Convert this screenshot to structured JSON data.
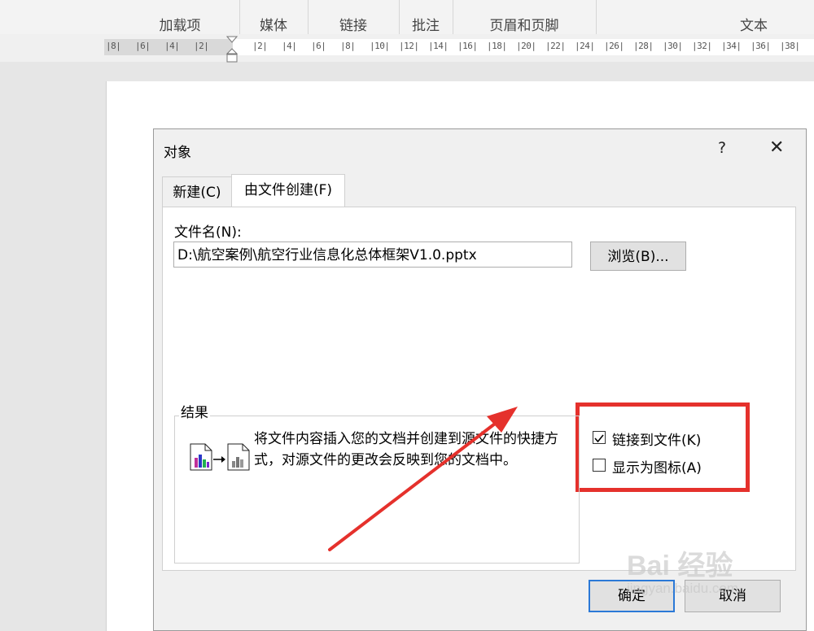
{
  "ribbon": {
    "groups": [
      "加载项",
      "媒体",
      "链接",
      "批注",
      "页眉和页脚",
      "文本"
    ]
  },
  "ruler": {
    "ticks": [
      "8",
      "6",
      "4",
      "2",
      "2",
      "4",
      "6",
      "8",
      "10",
      "12",
      "14",
      "16",
      "18",
      "20",
      "22",
      "24",
      "26",
      "28",
      "30",
      "32",
      "34",
      "36",
      "38"
    ]
  },
  "dialog": {
    "title": "对象",
    "help_label": "?",
    "close_label": "✕",
    "tabs": [
      {
        "label": "新建(C)",
        "mnemonic": "C"
      },
      {
        "label": "由文件创建(F)",
        "mnemonic": "F"
      }
    ],
    "file_label": "文件名(N):",
    "file_value": "D:\\航空案例\\航空行业信息化总体框架V1.0.pptx",
    "browse_label": "浏览(B)...",
    "link_label": "链接到文件(K)",
    "link_checked": true,
    "icon_label": "显示为图标(A)",
    "icon_checked": false,
    "result_title": "结果",
    "result_text": "将文件内容插入您的文档并创建到源文件的快捷方式，对源文件的更改会反映到您的文档中。",
    "ok_label": "确定",
    "cancel_label": "取消"
  },
  "annotation": {
    "highlight_color": "#e5312c",
    "arrow_color": "#e5312c"
  },
  "watermark": {
    "logo": "Bai 经验",
    "url": "jingyan.baidu.com"
  }
}
